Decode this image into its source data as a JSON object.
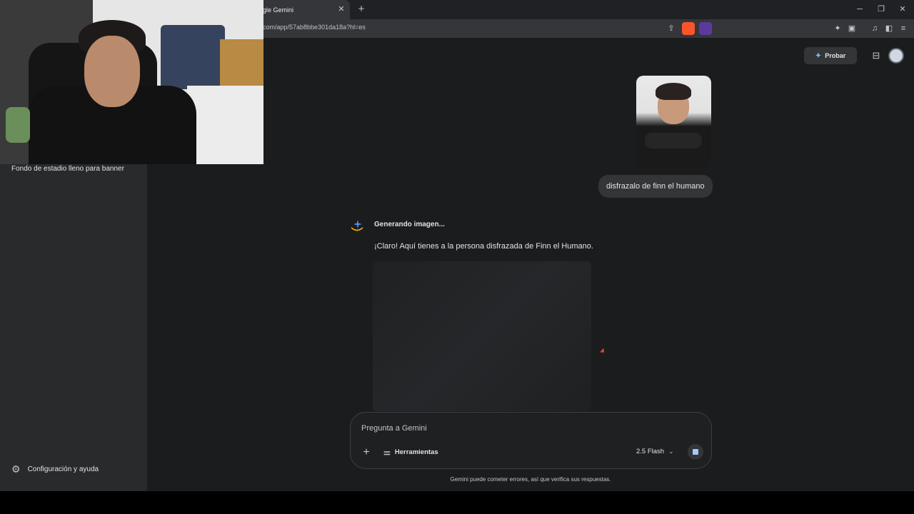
{
  "browser": {
    "tab_title": "gle Gemini",
    "tab_close": "✕",
    "new_tab": "+",
    "url": "com/app/57ab8bbe301da18a?hl=es",
    "window_minimize": "─",
    "window_restore": "❐",
    "window_close": "✕"
  },
  "sidebar": {
    "recent_item": "Fondo de estadio lleno para banner",
    "settings_label": "Configuración y ayuda"
  },
  "header": {
    "probar_label": "Probar"
  },
  "chat": {
    "user_message": "disfrazalo de finn el humano",
    "status": "Generando imagen...",
    "reply": "¡Claro! Aquí tienes a la persona disfrazada de Finn el Humano."
  },
  "composer": {
    "placeholder": "Pregunta a Gemini",
    "tools_label": "Herramientas",
    "model_label": "2.5 Flash"
  },
  "footer": {
    "disclaimer": "Gemini puede cometer errores, así que verifica sus respuestas."
  },
  "colors": {
    "app_background": "#1b1c1d",
    "sidebar_background": "#282a2c",
    "accent": "#a8c7fa"
  }
}
